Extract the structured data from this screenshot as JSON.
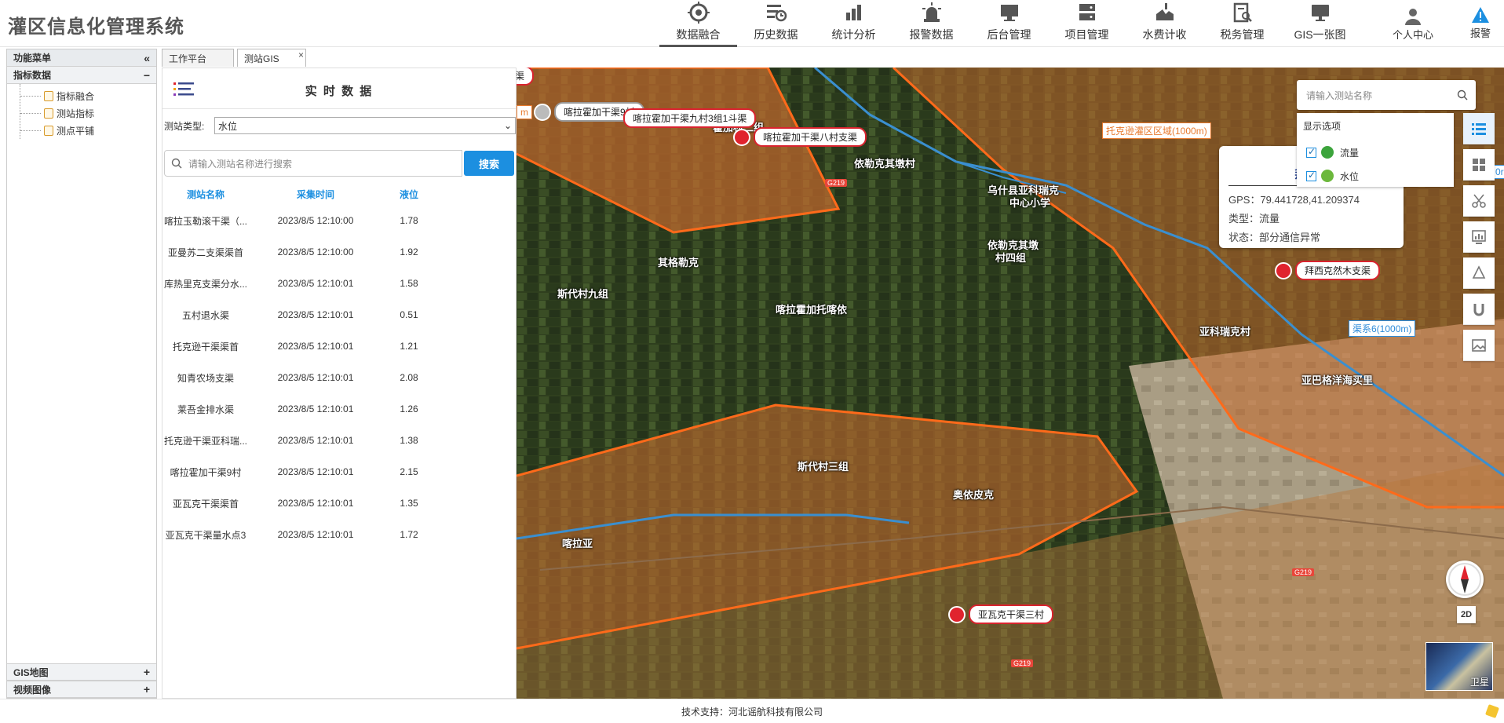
{
  "app": {
    "title": "灌区信息化管理系统"
  },
  "nav": [
    {
      "label": "数据融合",
      "icon": "target-icon",
      "active": true
    },
    {
      "label": "历史数据",
      "icon": "history-list-icon"
    },
    {
      "label": "统计分析",
      "icon": "bar-chart-icon"
    },
    {
      "label": "报警数据",
      "icon": "alarm-light-icon"
    },
    {
      "label": "后台管理",
      "icon": "monitor-icon"
    },
    {
      "label": "项目管理",
      "icon": "server-icon"
    },
    {
      "label": "水费计收",
      "icon": "pipe-icon"
    },
    {
      "label": "税务管理",
      "icon": "document-search-icon"
    },
    {
      "label": "GIS一张图",
      "icon": "screen-icon"
    }
  ],
  "user": {
    "label": "个人中心"
  },
  "alarm": {
    "label": "报警"
  },
  "sidebar": {
    "header": "功能菜单",
    "section": "指标数据",
    "items": [
      "指标融合",
      "测站指标",
      "测点平铺"
    ],
    "bottom": [
      "GIS地图",
      "视频图像"
    ]
  },
  "tabs": [
    {
      "label": "工作平台"
    },
    {
      "label": "测站GIS"
    }
  ],
  "panel": {
    "title": "实 时 数 据",
    "type_label": "测站类型:",
    "type_value": "水位",
    "search_placeholder": "请输入测站名称进行搜索",
    "search_button": "搜索",
    "columns": [
      "测站名称",
      "采集时间",
      "液位"
    ],
    "rows": [
      [
        "喀拉玉勒滚干渠（...",
        "2023/8/5 12:10:00",
        "1.78"
      ],
      [
        "亚曼苏二支渠渠首",
        "2023/8/5 12:10:00",
        "1.92"
      ],
      [
        "库热里克支渠分水...",
        "2023/8/5 12:10:01",
        "1.58"
      ],
      [
        "五村退水渠",
        "2023/8/5 12:10:01",
        "0.51"
      ],
      [
        "托克逊干渠渠首",
        "2023/8/5 12:10:01",
        "1.21"
      ],
      [
        "知青农场支渠",
        "2023/8/5 12:10:01",
        "2.08"
      ],
      [
        "莱吾金排水渠",
        "2023/8/5 12:10:01",
        "1.26"
      ],
      [
        "托克逊干渠亚科瑞...",
        "2023/8/5 12:10:01",
        "1.38"
      ],
      [
        "喀拉霍加干渠9村",
        "2023/8/5 12:10:01",
        "2.15"
      ],
      [
        "亚瓦克干渠渠首",
        "2023/8/5 12:10:01",
        "1.35"
      ],
      [
        "亚瓦克干渠量水点3",
        "2023/8/5 12:10:01",
        "1.72"
      ]
    ]
  },
  "map": {
    "search_placeholder": "请输入测站名称",
    "display_title": "显示选项",
    "options": [
      "流量",
      "水位"
    ],
    "popup": {
      "title": "拜西克",
      "gps": "GPS：79.441728,41.209374",
      "type": "类型：流量",
      "status": "状态：部分通信异常"
    },
    "pins": [
      "喀拉霍加干渠9村",
      "喀拉霍加干渠九村3组1斗渠",
      "喀拉霍加干渠八村支渠",
      "拜西克然木支渠",
      "亚瓦克干渠三村"
    ],
    "pin_partial": "斗渠",
    "zones": [
      "托克逊灌区区域(1000m)",
      "渠系6(1000m)"
    ],
    "zone_partial": "m",
    "zone_partial_right": "0r",
    "place_names": [
      "霍加村二组",
      "依勒克其墩村",
      "乌什县亚科瑞克",
      "中心小学",
      "依勒克其墩",
      "村四组",
      "其格勒克",
      "斯代村九组",
      "喀拉霍加托喀依",
      "亚科瑞克村",
      "亚巴格洋海买里",
      "斯代村三组",
      "奥依皮克",
      "喀拉亚"
    ],
    "roads": [
      "G219",
      "G219",
      "G219"
    ],
    "btn_2d": "2D",
    "basemap_label": "卫星"
  },
  "footer": {
    "text": "技术支持：河北谣航科技有限公司"
  }
}
